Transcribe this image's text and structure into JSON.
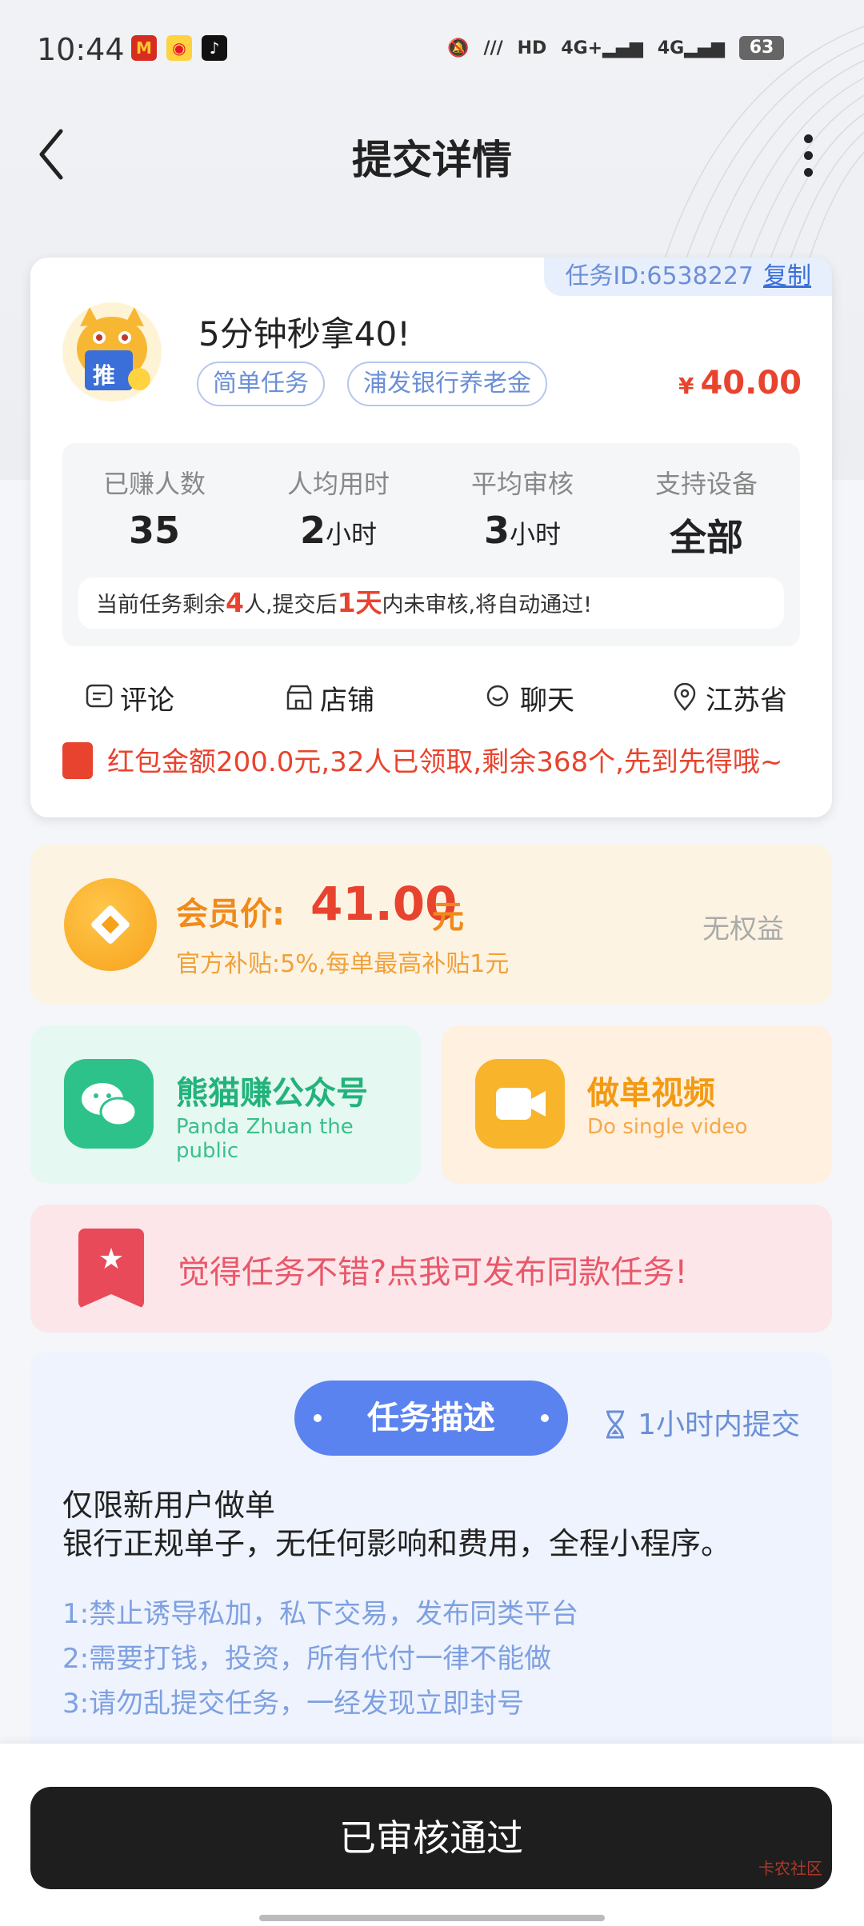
{
  "status_bar": {
    "time": "10:44",
    "battery": "63"
  },
  "header": {
    "title": "提交详情"
  },
  "task": {
    "id_label": "任务ID:6538227",
    "copy_label": "复制",
    "name": "5分钟秒拿40!",
    "tags": [
      "简单任务",
      "浦发银行养老金"
    ],
    "currency": "¥",
    "price": "40.00",
    "avatar_text": "推",
    "stats": [
      {
        "label": "已赚人数",
        "value": "35",
        "unit": ""
      },
      {
        "label": "人均用时",
        "value": "2",
        "unit": "小时"
      },
      {
        "label": "平均审核",
        "value": "3",
        "unit": "小时"
      },
      {
        "label": "支持设备",
        "value": "全部",
        "unit": ""
      }
    ],
    "notice": {
      "p1": "当前任务剩余",
      "remain": "4",
      "p2": "人,提交后",
      "days": "1天",
      "p3": "内未审核,将自动通过!"
    },
    "actions": [
      "评论",
      "店铺",
      "聊天",
      "江苏省"
    ],
    "redpacket": "红包金额200.0元,32人已领取,剩余368个,先到先得哦~"
  },
  "member": {
    "label": "会员价:",
    "price": "41.00",
    "unit": "元",
    "subsidy": "官方补贴:5%,每单最高补贴1元",
    "right": "无权益"
  },
  "boxes": {
    "wechat": {
      "title": "熊猫赚公众号",
      "sub": "Panda Zhuan the public"
    },
    "video": {
      "title": "做单视频",
      "sub": "Do single video"
    }
  },
  "publish": {
    "text": "觉得任务不错?点我可发布同款任务!"
  },
  "description": {
    "pill": "任务描述",
    "time_limit": "1小时内提交",
    "line1": "仅限新用户做单",
    "line2": "银行正规单子，无任何影响和费用，全程小程序。",
    "rules": [
      "1:禁止诱导私加，私下交易，发布同类平台",
      "2:需要打钱，投资，所有代付一律不能做",
      "3:请勿乱提交任务，一经发现立即封号"
    ]
  },
  "bottom": {
    "button": "已审核通过",
    "watermark": "卡农社区"
  },
  "colors": {
    "accent_blue": "#5b83ef",
    "price_red": "#e8432e",
    "member_orange": "#f08a1a",
    "button_dark": "#1e1e1e"
  }
}
